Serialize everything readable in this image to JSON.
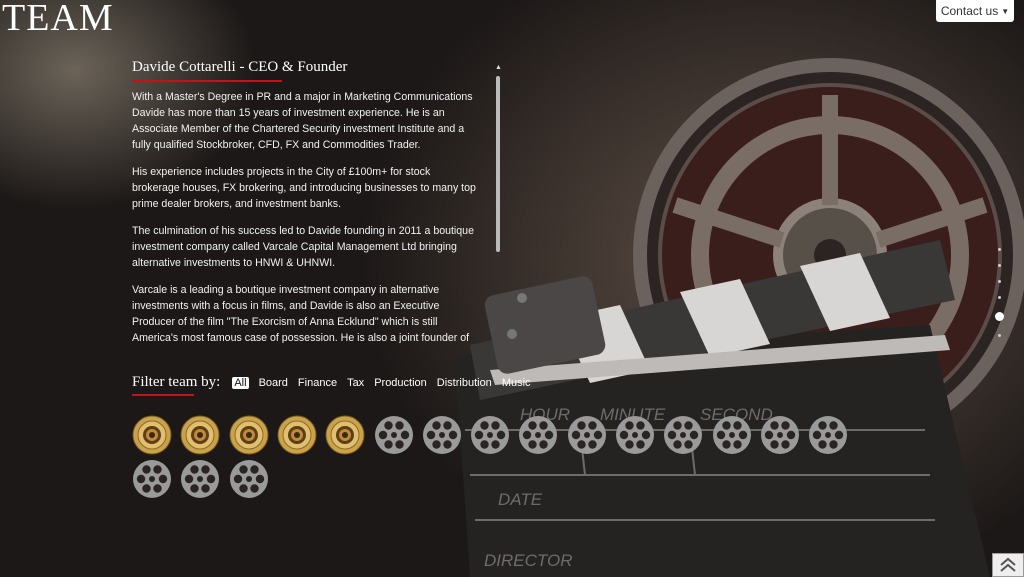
{
  "brand": {
    "title": "TEAM"
  },
  "header": {
    "contact_label": "Contact us"
  },
  "bio": {
    "name": "Davide Cottarelli - CEO & Founder",
    "paragraphs": [
      "With a Master's Degree in PR and a major in Marketing Communications Davide has more than 15 years of investment experience. He is an Associate Member of the Chartered Security investment Institute and a fully qualified Stockbroker, CFD, FX and Commodities Trader.",
      "His experience includes projects in the City of £100m+ for stock brokerage houses, FX brokering, and introducing businesses to many top prime dealer brokers, and investment banks.",
      "The culmination of his success led to Davide founding in 2011 a boutique investment company called Varcale Capital Management Ltd bringing alternative investments to HNWI & UHNWI.",
      "Varcale is a leading a boutique investment company in alternative investments with a focus in films, and Davide is also an Executive Producer of the film \"The Exorcism of Anna Ecklund\" which is still America's most famous case of possession. He is also a joint founder of the new China UK"
    ]
  },
  "filter": {
    "label": "Filter team by:",
    "options": [
      "All",
      "Board",
      "Finance",
      "Tax",
      "Production",
      "Distribution",
      "Music"
    ],
    "active": "All"
  },
  "team_grid": {
    "members": [
      {
        "style": "gold"
      },
      {
        "style": "gold"
      },
      {
        "style": "gold"
      },
      {
        "style": "gold"
      },
      {
        "style": "gold"
      },
      {
        "style": "grey"
      },
      {
        "style": "grey"
      },
      {
        "style": "grey"
      },
      {
        "style": "grey"
      },
      {
        "style": "grey"
      },
      {
        "style": "grey"
      },
      {
        "style": "grey"
      },
      {
        "style": "grey"
      },
      {
        "style": "grey"
      },
      {
        "style": "grey"
      },
      {
        "style": "grey"
      },
      {
        "style": "grey"
      },
      {
        "style": "grey"
      }
    ]
  },
  "clapper": {
    "hour": "HOUR",
    "minute": "MINUTE",
    "second": "SECOND",
    "date": "DATE",
    "director": "DIRECTOR"
  },
  "pagination": {
    "count": 6,
    "active_index": 4
  },
  "colors": {
    "accent": "#c0141c",
    "gold": "#c9a24a",
    "grey": "#9a9a9a"
  },
  "icons": {
    "contact_caret": "caret-down-icon",
    "to_top": "double-chevron-up-icon"
  }
}
